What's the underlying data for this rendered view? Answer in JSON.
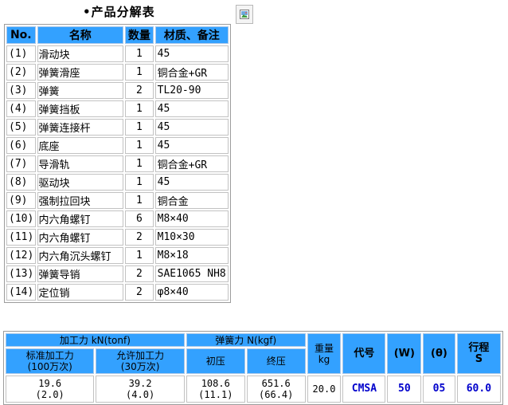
{
  "title": "•产品分解表",
  "parts_table": {
    "headers": [
      "No.",
      "名称",
      "数量",
      "材质、备注"
    ],
    "rows": [
      {
        "no": "(1)",
        "name": "滑动块",
        "qty": "1",
        "material": "45"
      },
      {
        "no": "(2)",
        "name": "弹簧滑座",
        "qty": "1",
        "material": "铜合金+GR"
      },
      {
        "no": "(3)",
        "name": "弹簧",
        "qty": "2",
        "material": "TL20-90"
      },
      {
        "no": "(4)",
        "name": "弹簧挡板",
        "qty": "1",
        "material": "45"
      },
      {
        "no": "(5)",
        "name": "弹簧连接杆",
        "qty": "1",
        "material": "45"
      },
      {
        "no": "(6)",
        "name": "底座",
        "qty": "1",
        "material": "45"
      },
      {
        "no": "(7)",
        "name": "导滑轨",
        "qty": "1",
        "material": "铜合金+GR"
      },
      {
        "no": "(8)",
        "name": "驱动块",
        "qty": "1",
        "material": "45"
      },
      {
        "no": "(9)",
        "name": "强制拉回块",
        "qty": "1",
        "material": "铜合金"
      },
      {
        "no": "(10)",
        "name": "内六角螺钉",
        "qty": "6",
        "material": "M8×40"
      },
      {
        "no": "(11)",
        "name": "内六角螺钉",
        "qty": "2",
        "material": "M10×30"
      },
      {
        "no": "(12)",
        "name": "内六角沉头螺钉",
        "qty": "1",
        "material": "M8×18"
      },
      {
        "no": "(13)",
        "name": "弹簧导销",
        "qty": "2",
        "material": "SAE1065 NH8"
      },
      {
        "no": "(14)",
        "name": "定位销",
        "qty": "2",
        "material": "φ8×40"
      }
    ]
  },
  "spec_table": {
    "group_processing": "加工力 kN(tonf)",
    "group_spring": "弹簧力 N(kgf)",
    "standard_line1": "标准加工力",
    "standard_line2": "(100万次)",
    "allowed_line1": "允许加工力",
    "allowed_line2": "(30万次)",
    "initial": "初压",
    "final": "终压",
    "weight_line1": "重量",
    "weight_line2": "kg",
    "code": "代号",
    "w": "(W)",
    "theta": "(θ)",
    "stroke_line1": "行程",
    "stroke_line2": "S",
    "values": {
      "standard_1": "19.6",
      "standard_2": "(2.0)",
      "allowed_1": "39.2",
      "allowed_2": "(4.0)",
      "initial_1": "108.6",
      "initial_2": "(11.1)",
      "final_1": "651.6",
      "final_2": "(66.4)",
      "weight": "20.0",
      "code": "CMSA",
      "w": "50",
      "theta": "05",
      "stroke": "60.0"
    }
  }
}
